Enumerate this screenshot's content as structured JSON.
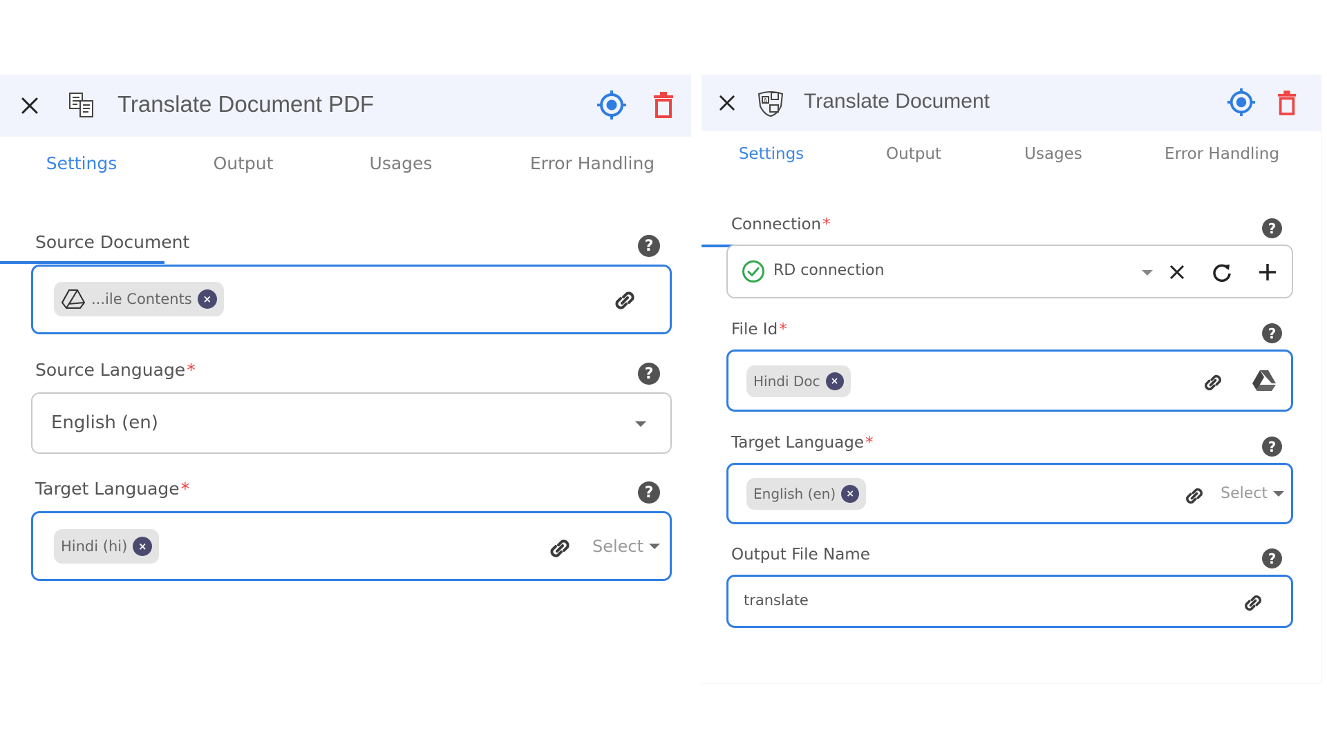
{
  "panels": [
    {
      "title": "Translate Document PDF",
      "app_icon": "translate-document-icon",
      "actions": {
        "close": "close-icon",
        "locate": "target-icon",
        "delete": "trash-icon"
      },
      "tabs": [
        {
          "label": "Settings",
          "active": true
        },
        {
          "label": "Output",
          "active": false
        },
        {
          "label": "Usages",
          "active": false
        },
        {
          "label": "Error Handling",
          "active": false
        }
      ],
      "fields": {
        "source_document": {
          "label": "Source Document",
          "required": false,
          "chip": "...ile Contents",
          "chip_icon": "google-drive-outline-icon",
          "link_icon": "link-icon",
          "help": "?"
        },
        "source_language": {
          "label": "Source Language",
          "required": true,
          "value": "English (en)",
          "help": "?"
        },
        "target_language": {
          "label": "Target Language",
          "required": true,
          "chip": "Hindi (hi)",
          "link_icon": "link-icon",
          "select_placeholder": "Select",
          "help": "?"
        }
      }
    },
    {
      "title": "Translate Document",
      "app_icon": "translate-icon",
      "actions": {
        "close": "close-icon",
        "locate": "target-icon",
        "delete": "trash-icon"
      },
      "tabs": [
        {
          "label": "Settings",
          "active": true
        },
        {
          "label": "Output",
          "active": false
        },
        {
          "label": "Usages",
          "active": false
        },
        {
          "label": "Error Handling",
          "active": false
        }
      ],
      "fields": {
        "connection": {
          "label": "Connection",
          "required": true,
          "value": "RD connection",
          "status": "connected",
          "help": "?"
        },
        "file_id": {
          "label": "File Id",
          "required": true,
          "chip": "Hindi Doc",
          "link_icon": "link-icon",
          "drive_icon": "google-drive-icon",
          "help": "?"
        },
        "target_language": {
          "label": "Target Language",
          "required": true,
          "chip": "English (en)",
          "link_icon": "link-icon",
          "select_placeholder": "Select",
          "help": "?"
        },
        "output_file_name": {
          "label": "Output File Name",
          "required": false,
          "value": "translate",
          "link_icon": "link-icon",
          "help": "?"
        }
      }
    }
  ],
  "required_marker": "*",
  "chip_remove_glyph": "×",
  "colors": {
    "accent": "#2f7de2",
    "delete": "#f04444",
    "success": "#2fa84f",
    "header_bg": "#f1f4fc",
    "required": "#ef4444"
  }
}
